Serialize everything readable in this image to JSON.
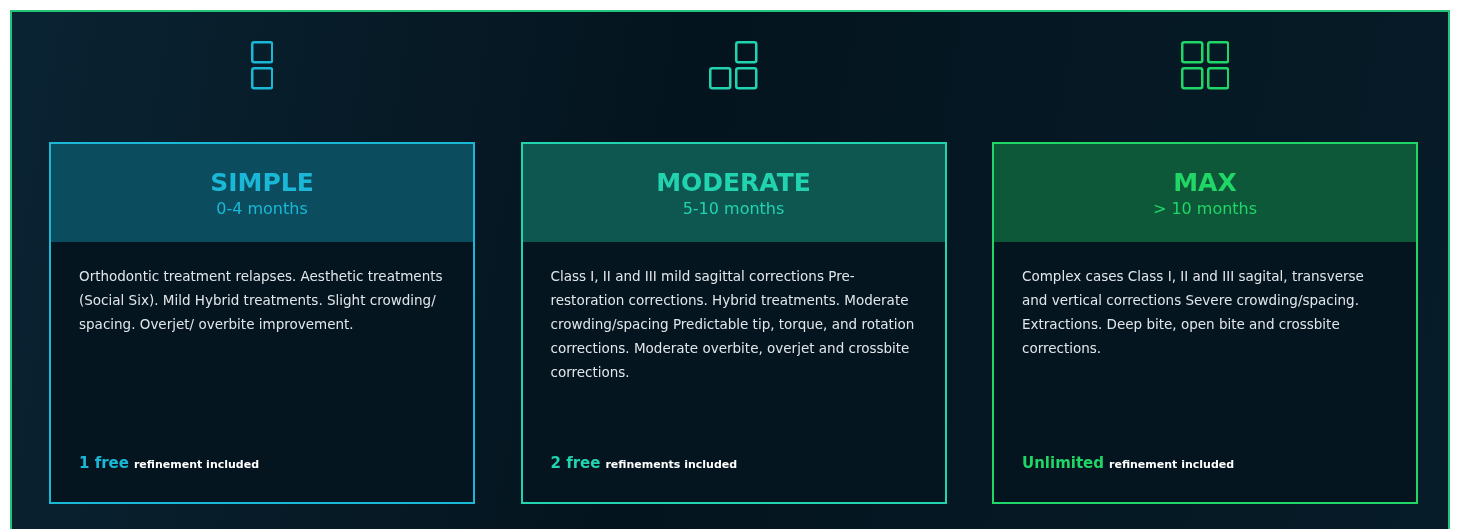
{
  "plans": [
    {
      "title": "SIMPLE",
      "duration": "0-4 months",
      "color": "#1ab8d6",
      "description": "Orthodontic treatment relapses. Aesthetic treatments (Social Six). Mild Hybrid treatments. Slight crowding/ spacing. Overjet/ overbite improvement.",
      "highlight": "1 free",
      "note": "refinement included"
    },
    {
      "title": "MODERATE",
      "duration": "5-10 months",
      "color": "#22d3b0",
      "description": "Class I, II and III mild sagittal corrections Pre-restoration corrections. Hybrid treatments. Moderate crowding/spacing Predictable tip, torque, and rotation corrections. Moderate overbite, overjet and crossbite corrections.",
      "highlight": "2 free",
      "note": "refinements included"
    },
    {
      "title": "MAX",
      "duration": "> 10 months",
      "color": "#20d667",
      "description": "Complex cases Class I, II and III sagital, transverse and vertical corrections Severe crowding/spacing. Extractions. Deep bite, open bite and crossbite corrections.",
      "highlight": "Unlimited",
      "note": "refinement included"
    }
  ]
}
